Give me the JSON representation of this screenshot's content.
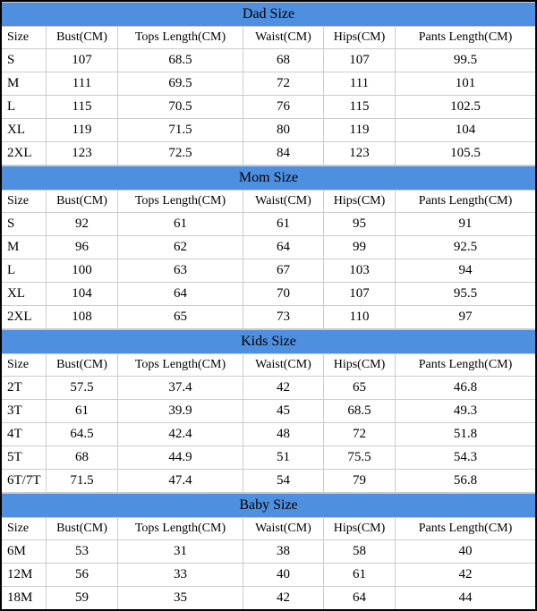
{
  "columns": {
    "size": "Size",
    "bust": "Bust(CM)",
    "tops": "Tops Length(CM)",
    "waist": "Waist(CM)",
    "hips": "Hips(CM)",
    "pants": "Pants Length(CM)"
  },
  "sections": [
    {
      "title": "Dad Size",
      "rows": [
        {
          "size": "S",
          "bust": "107",
          "tops": "68.5",
          "waist": "68",
          "hips": "107",
          "pants": "99.5"
        },
        {
          "size": "M",
          "bust": "111",
          "tops": "69.5",
          "waist": "72",
          "hips": "111",
          "pants": "101"
        },
        {
          "size": "L",
          "bust": "115",
          "tops": "70.5",
          "waist": "76",
          "hips": "115",
          "pants": "102.5"
        },
        {
          "size": "XL",
          "bust": "119",
          "tops": "71.5",
          "waist": "80",
          "hips": "119",
          "pants": "104"
        },
        {
          "size": "2XL",
          "bust": "123",
          "tops": "72.5",
          "waist": "84",
          "hips": "123",
          "pants": "105.5"
        }
      ]
    },
    {
      "title": "Mom Size",
      "rows": [
        {
          "size": "S",
          "bust": "92",
          "tops": "61",
          "waist": "61",
          "hips": "95",
          "pants": "91"
        },
        {
          "size": "M",
          "bust": "96",
          "tops": "62",
          "waist": "64",
          "hips": "99",
          "pants": "92.5"
        },
        {
          "size": "L",
          "bust": "100",
          "tops": "63",
          "waist": "67",
          "hips": "103",
          "pants": "94"
        },
        {
          "size": "XL",
          "bust": "104",
          "tops": "64",
          "waist": "70",
          "hips": "107",
          "pants": "95.5"
        },
        {
          "size": "2XL",
          "bust": "108",
          "tops": "65",
          "waist": "73",
          "hips": "110",
          "pants": "97"
        }
      ]
    },
    {
      "title": "Kids Size",
      "rows": [
        {
          "size": "2T",
          "bust": "57.5",
          "tops": "37.4",
          "waist": "42",
          "hips": "65",
          "pants": "46.8"
        },
        {
          "size": "3T",
          "bust": "61",
          "tops": "39.9",
          "waist": "45",
          "hips": "68.5",
          "pants": "49.3"
        },
        {
          "size": "4T",
          "bust": "64.5",
          "tops": "42.4",
          "waist": "48",
          "hips": "72",
          "pants": "51.8"
        },
        {
          "size": "5T",
          "bust": "68",
          "tops": "44.9",
          "waist": "51",
          "hips": "75.5",
          "pants": "54.3"
        },
        {
          "size": "6T/7T",
          "bust": "71.5",
          "tops": "47.4",
          "waist": "54",
          "hips": "79",
          "pants": "56.8"
        }
      ]
    },
    {
      "title": "Baby Size",
      "rows": [
        {
          "size": "6M",
          "bust": "53",
          "tops": "31",
          "waist": "38",
          "hips": "58",
          "pants": "40"
        },
        {
          "size": "12M",
          "bust": "56",
          "tops": "33",
          "waist": "40",
          "hips": "61",
          "pants": "42"
        },
        {
          "size": "18M",
          "bust": "59",
          "tops": "35",
          "waist": "42",
          "hips": "64",
          "pants": "44"
        }
      ]
    }
  ]
}
